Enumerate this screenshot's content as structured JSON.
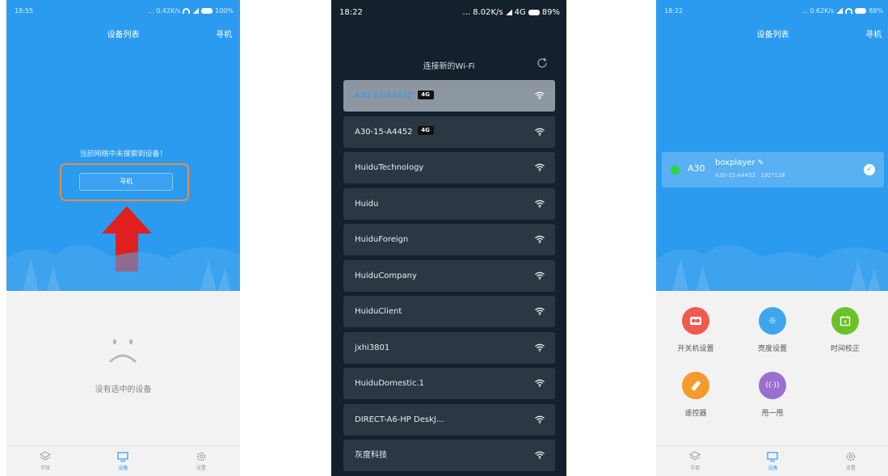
{
  "colors": {
    "primary_blue": "#2b9bf0",
    "highlight_orange": "#e58b47",
    "arrow_red": "#e0201e",
    "dark_bg": "#14202c",
    "online_green": "#2fd63a"
  },
  "panel1": {
    "status": {
      "time": "18:55",
      "indicators": "... 0.42K/s",
      "battery": "100%"
    },
    "title": "设备列表",
    "search_link": "寻机",
    "empty_message": "当前网络中未搜索到设备！",
    "search_button": "寻机",
    "no_device_text": "没有选中的设备",
    "tabs": [
      {
        "label": "节目",
        "icon": "layers-icon"
      },
      {
        "label": "设备",
        "icon": "monitor-icon"
      },
      {
        "label": "设置",
        "icon": "gear-icon"
      }
    ],
    "active_tab": "设备"
  },
  "panel2": {
    "status": {
      "time": "18:22",
      "indicators": "... 8.02K/s",
      "network": "4G",
      "battery": "89%"
    },
    "title": "连接新的Wi-Fi",
    "networks": [
      {
        "ssid": "A30-15-A4452",
        "badge": "4G",
        "selected": true
      },
      {
        "ssid": "A30-15-A4452",
        "badge": "4G",
        "selected": false
      },
      {
        "ssid": "HuiduTechnology",
        "badge": "",
        "selected": false
      },
      {
        "ssid": "Huidu",
        "badge": "",
        "selected": false
      },
      {
        "ssid": "HuiduForeign",
        "badge": "",
        "selected": false
      },
      {
        "ssid": "HuiduCompany",
        "badge": "",
        "selected": false
      },
      {
        "ssid": "HuiduClient",
        "badge": "",
        "selected": false
      },
      {
        "ssid": "jxhi3801",
        "badge": "",
        "selected": false
      },
      {
        "ssid": "HuiduDomestic.1",
        "badge": "",
        "selected": false
      },
      {
        "ssid": "DIRECT-A6-HP DeskJ...",
        "badge": "",
        "selected": false
      },
      {
        "ssid": "灰度科技",
        "badge": "",
        "selected": false
      }
    ]
  },
  "panel3": {
    "status": {
      "time": "18:22",
      "indicators": "... 0.62K/s",
      "battery": "88%"
    },
    "title": "设备列表",
    "search_link": "寻机",
    "device": {
      "model": "A30",
      "name": "boxplayer",
      "id": "A30-15-A4452",
      "resolution": "192*128",
      "online": true
    },
    "functions": [
      {
        "label": "开关机设置",
        "color": "#ef5a4e",
        "icon": "power-switch-icon"
      },
      {
        "label": "亮度设置",
        "color": "#3fa6ee",
        "icon": "brightness-icon"
      },
      {
        "label": "时间校正",
        "color": "#6cc12a",
        "icon": "calendar-icon"
      },
      {
        "label": "遥控器",
        "color": "#f59a2d",
        "icon": "remote-icon"
      },
      {
        "label": "甩一甩",
        "color": "#9a6fd1",
        "icon": "shake-icon"
      }
    ],
    "tabs": [
      {
        "label": "节目",
        "icon": "layers-icon"
      },
      {
        "label": "设备",
        "icon": "monitor-icon"
      },
      {
        "label": "设置",
        "icon": "gear-icon"
      }
    ],
    "active_tab": "设备"
  }
}
